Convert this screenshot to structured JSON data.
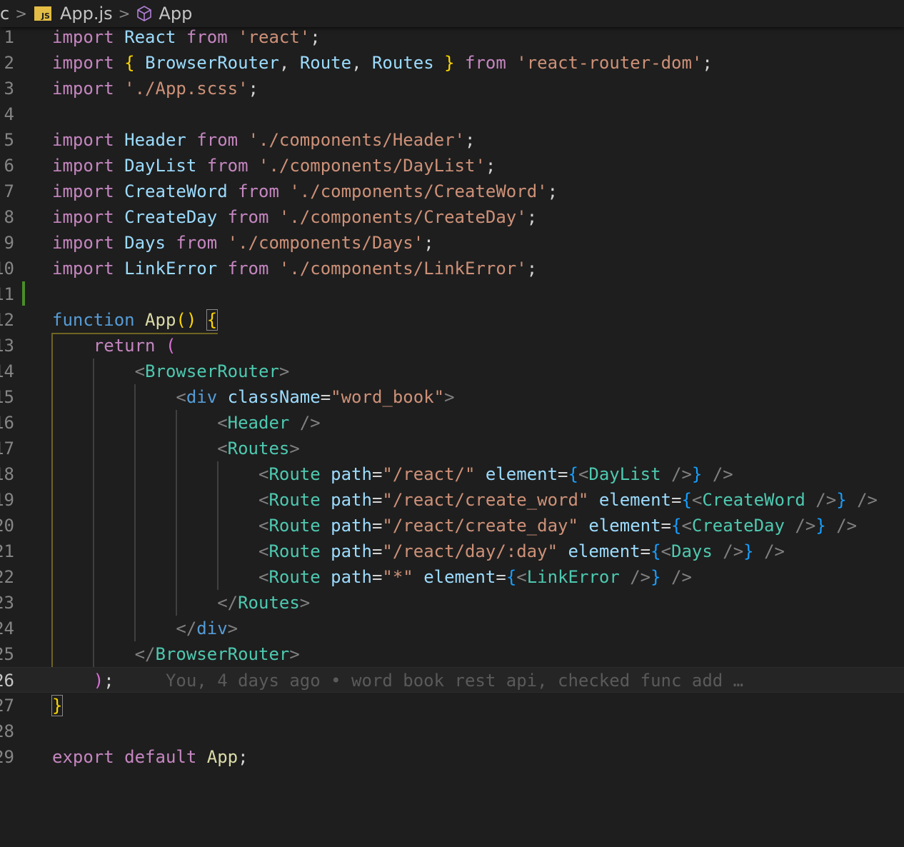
{
  "breadcrumb": {
    "prefix": "c",
    "file_icon": "js-file-icon",
    "file_icon_text": "JS",
    "file": "App.js",
    "symbol_icon": "cube-icon",
    "symbol": "App"
  },
  "editor": {
    "current_line": 26,
    "blame": "You, 4 days ago • word book rest api, checked func add …",
    "lines": [
      {
        "n": "1"
      },
      {
        "n": "2"
      },
      {
        "n": "3"
      },
      {
        "n": "4"
      },
      {
        "n": "5"
      },
      {
        "n": "6"
      },
      {
        "n": "7"
      },
      {
        "n": "8"
      },
      {
        "n": "9"
      },
      {
        "n": "10"
      },
      {
        "n": "11"
      },
      {
        "n": "12"
      },
      {
        "n": "13"
      },
      {
        "n": "14"
      },
      {
        "n": "15"
      },
      {
        "n": "16"
      },
      {
        "n": "17"
      },
      {
        "n": "18"
      },
      {
        "n": "19"
      },
      {
        "n": "20"
      },
      {
        "n": "21"
      },
      {
        "n": "22"
      },
      {
        "n": "23"
      },
      {
        "n": "24"
      },
      {
        "n": "25"
      },
      {
        "n": "26"
      },
      {
        "n": "27"
      },
      {
        "n": "28"
      },
      {
        "n": "29"
      }
    ],
    "tokens": {
      "import": "import",
      "from": "from",
      "function": "function",
      "return": "return",
      "export": "export",
      "default": "default",
      "React": "React",
      "react_str": "'react'",
      "BrowserRouter": "BrowserRouter",
      "Route": "Route",
      "Routes": "Routes",
      "router_str": "'react-router-dom'",
      "scss_str": "'./App.scss'",
      "Header": "Header",
      "header_str": "'./components/Header'",
      "DayList": "DayList",
      "daylist_str": "'./components/DayList'",
      "CreateWord": "CreateWord",
      "createword_str": "'./components/CreateWord'",
      "CreateDay": "CreateDay",
      "createday_str": "'./components/CreateDay'",
      "Days": "Days",
      "days_str": "'./components/Days'",
      "LinkError": "LinkError",
      "linkerror_str": "'./components/LinkError'",
      "App": "App",
      "div": "div",
      "className": "className",
      "word_book": "\"word_book\"",
      "path": "path",
      "element": "element",
      "p_react": "\"/react/\"",
      "p_create_word": "\"/react/create_word\"",
      "p_create_day": "\"/react/create_day\"",
      "p_day": "\"/react/day/:day\"",
      "p_star": "\"*\""
    }
  }
}
